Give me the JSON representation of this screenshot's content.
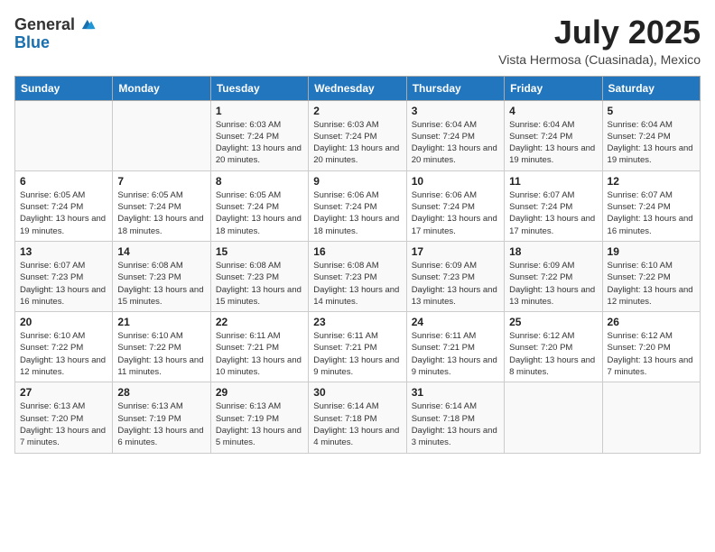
{
  "header": {
    "logo_general": "General",
    "logo_blue": "Blue",
    "title": "July 2025",
    "location": "Vista Hermosa (Cuasinada), Mexico"
  },
  "days_of_week": [
    "Sunday",
    "Monday",
    "Tuesday",
    "Wednesday",
    "Thursday",
    "Friday",
    "Saturday"
  ],
  "weeks": [
    [
      {
        "day": "",
        "info": ""
      },
      {
        "day": "",
        "info": ""
      },
      {
        "day": "1",
        "info": "Sunrise: 6:03 AM\nSunset: 7:24 PM\nDaylight: 13 hours and 20 minutes."
      },
      {
        "day": "2",
        "info": "Sunrise: 6:03 AM\nSunset: 7:24 PM\nDaylight: 13 hours and 20 minutes."
      },
      {
        "day": "3",
        "info": "Sunrise: 6:04 AM\nSunset: 7:24 PM\nDaylight: 13 hours and 20 minutes."
      },
      {
        "day": "4",
        "info": "Sunrise: 6:04 AM\nSunset: 7:24 PM\nDaylight: 13 hours and 19 minutes."
      },
      {
        "day": "5",
        "info": "Sunrise: 6:04 AM\nSunset: 7:24 PM\nDaylight: 13 hours and 19 minutes."
      }
    ],
    [
      {
        "day": "6",
        "info": "Sunrise: 6:05 AM\nSunset: 7:24 PM\nDaylight: 13 hours and 19 minutes."
      },
      {
        "day": "7",
        "info": "Sunrise: 6:05 AM\nSunset: 7:24 PM\nDaylight: 13 hours and 18 minutes."
      },
      {
        "day": "8",
        "info": "Sunrise: 6:05 AM\nSunset: 7:24 PM\nDaylight: 13 hours and 18 minutes."
      },
      {
        "day": "9",
        "info": "Sunrise: 6:06 AM\nSunset: 7:24 PM\nDaylight: 13 hours and 18 minutes."
      },
      {
        "day": "10",
        "info": "Sunrise: 6:06 AM\nSunset: 7:24 PM\nDaylight: 13 hours and 17 minutes."
      },
      {
        "day": "11",
        "info": "Sunrise: 6:07 AM\nSunset: 7:24 PM\nDaylight: 13 hours and 17 minutes."
      },
      {
        "day": "12",
        "info": "Sunrise: 6:07 AM\nSunset: 7:24 PM\nDaylight: 13 hours and 16 minutes."
      }
    ],
    [
      {
        "day": "13",
        "info": "Sunrise: 6:07 AM\nSunset: 7:23 PM\nDaylight: 13 hours and 16 minutes."
      },
      {
        "day": "14",
        "info": "Sunrise: 6:08 AM\nSunset: 7:23 PM\nDaylight: 13 hours and 15 minutes."
      },
      {
        "day": "15",
        "info": "Sunrise: 6:08 AM\nSunset: 7:23 PM\nDaylight: 13 hours and 15 minutes."
      },
      {
        "day": "16",
        "info": "Sunrise: 6:08 AM\nSunset: 7:23 PM\nDaylight: 13 hours and 14 minutes."
      },
      {
        "day": "17",
        "info": "Sunrise: 6:09 AM\nSunset: 7:23 PM\nDaylight: 13 hours and 13 minutes."
      },
      {
        "day": "18",
        "info": "Sunrise: 6:09 AM\nSunset: 7:22 PM\nDaylight: 13 hours and 13 minutes."
      },
      {
        "day": "19",
        "info": "Sunrise: 6:10 AM\nSunset: 7:22 PM\nDaylight: 13 hours and 12 minutes."
      }
    ],
    [
      {
        "day": "20",
        "info": "Sunrise: 6:10 AM\nSunset: 7:22 PM\nDaylight: 13 hours and 12 minutes."
      },
      {
        "day": "21",
        "info": "Sunrise: 6:10 AM\nSunset: 7:22 PM\nDaylight: 13 hours and 11 minutes."
      },
      {
        "day": "22",
        "info": "Sunrise: 6:11 AM\nSunset: 7:21 PM\nDaylight: 13 hours and 10 minutes."
      },
      {
        "day": "23",
        "info": "Sunrise: 6:11 AM\nSunset: 7:21 PM\nDaylight: 13 hours and 9 minutes."
      },
      {
        "day": "24",
        "info": "Sunrise: 6:11 AM\nSunset: 7:21 PM\nDaylight: 13 hours and 9 minutes."
      },
      {
        "day": "25",
        "info": "Sunrise: 6:12 AM\nSunset: 7:20 PM\nDaylight: 13 hours and 8 minutes."
      },
      {
        "day": "26",
        "info": "Sunrise: 6:12 AM\nSunset: 7:20 PM\nDaylight: 13 hours and 7 minutes."
      }
    ],
    [
      {
        "day": "27",
        "info": "Sunrise: 6:13 AM\nSunset: 7:20 PM\nDaylight: 13 hours and 7 minutes."
      },
      {
        "day": "28",
        "info": "Sunrise: 6:13 AM\nSunset: 7:19 PM\nDaylight: 13 hours and 6 minutes."
      },
      {
        "day": "29",
        "info": "Sunrise: 6:13 AM\nSunset: 7:19 PM\nDaylight: 13 hours and 5 minutes."
      },
      {
        "day": "30",
        "info": "Sunrise: 6:14 AM\nSunset: 7:18 PM\nDaylight: 13 hours and 4 minutes."
      },
      {
        "day": "31",
        "info": "Sunrise: 6:14 AM\nSunset: 7:18 PM\nDaylight: 13 hours and 3 minutes."
      },
      {
        "day": "",
        "info": ""
      },
      {
        "day": "",
        "info": ""
      }
    ]
  ]
}
